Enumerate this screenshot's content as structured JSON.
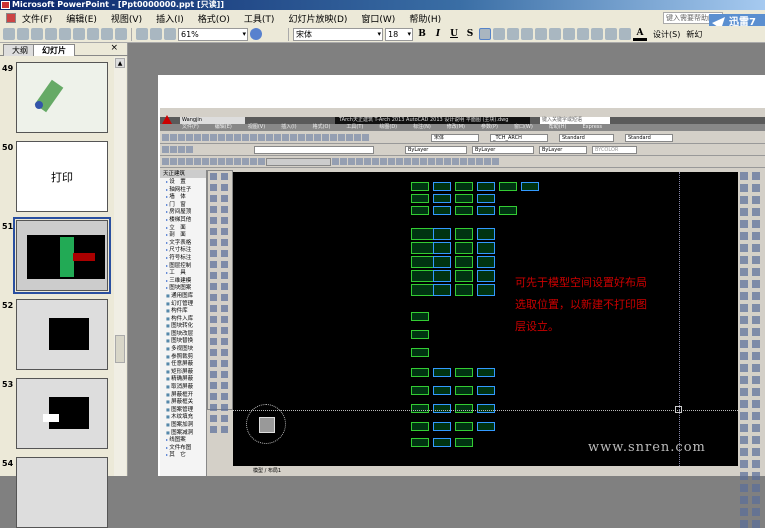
{
  "window": {
    "title": "Microsoft PowerPoint - [Ppt0000000.ppt [只读]]"
  },
  "menu": [
    "文件(F)",
    "编辑(E)",
    "视图(V)",
    "插入(I)",
    "格式(O)",
    "工具(T)",
    "幻灯片放映(D)",
    "窗口(W)",
    "帮助(H)"
  ],
  "help_search": "键入需要帮助的问题",
  "brand": "迅雷7",
  "toolbar": {
    "zoom": "61%",
    "font": "宋体",
    "size": "18",
    "bold": "B",
    "italic": "I",
    "underline": "U",
    "shadow": "S",
    "font_color": "A",
    "design": "设计(S)",
    "new_slide": "新幻"
  },
  "panel": {
    "tabs": [
      "大纲",
      "幻灯片"
    ],
    "close": "×",
    "slides": [
      {
        "num": "49",
        "text": ""
      },
      {
        "num": "50",
        "text": "打印"
      },
      {
        "num": "51",
        "text": ""
      },
      {
        "num": "52",
        "text": ""
      },
      {
        "num": "53",
        "text": ""
      },
      {
        "num": "54",
        "text": ""
      }
    ]
  },
  "cad": {
    "workspace": "Wangjin",
    "title": "TArch天正建筑 T-Arch 2013  AutoCAD 2013  设计说明 平面图 (主块).dwg",
    "search": "键入关键字或短语",
    "menus": [
      "文件(F)",
      "编辑(E)",
      "视图(V)",
      "插入(I)",
      "格式(O)",
      "工具(T)",
      "绘图(D)",
      "标注(N)",
      "修改(M)",
      "参数(P)",
      "窗口(W)",
      "帮助(H)",
      "Express"
    ],
    "styles": [
      "宋体",
      "_TCH_ARCH",
      "Standard",
      "Standard"
    ],
    "layer_row": [
      "ByLayer",
      "ByLayer",
      "ByLayer",
      "BYCOLOR"
    ],
    "palette_header": "天正建筑",
    "palette": [
      "设　置",
      "轴网柱子",
      "墙　体",
      "门　窗",
      "房间屋顶",
      "楼梯其他",
      "立　面",
      "剖　面",
      "文字表格",
      "尺寸标注",
      "符号标注",
      "图层控制",
      "工　具",
      "三维建模",
      "图块图案",
      "通用图库",
      "幻灯管理",
      "构件库",
      "构件入库",
      "图块转化",
      "图块改层",
      "图块替换",
      "多视图块",
      "参照裁剪",
      "任意屏蔽",
      "矩形屏蔽",
      "精确屏蔽",
      "取消屏蔽",
      "屏蔽框开",
      "屏蔽框关",
      "图案管理",
      "木纹填充",
      "图案加洞",
      "图案减洞",
      "线图案",
      "文件布图",
      "其　它"
    ],
    "status": "模型 / 布局1",
    "note_lines": [
      "可先于模型空间设置好布局",
      "选取位置，以新建不打印图",
      "层设立。"
    ],
    "watermark": "www.snren.com"
  },
  "colors": {
    "note": "#cc0000",
    "drawing_bg": "#000000",
    "lines": "#33cc33"
  }
}
